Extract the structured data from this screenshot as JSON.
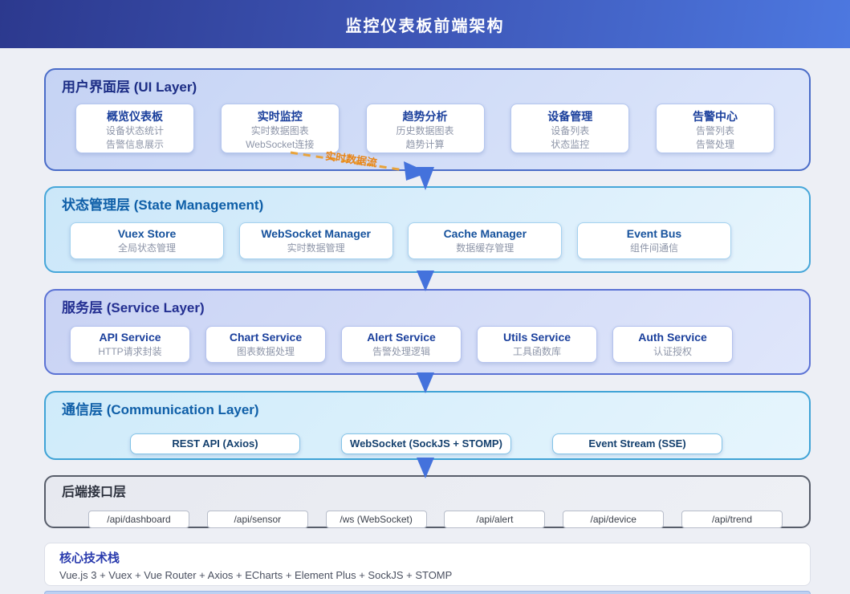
{
  "header": {
    "title": "监控仪表板前端架构"
  },
  "layers": [
    {
      "title": "用户界面层 (UI Layer)",
      "cards": [
        {
          "title": "概览仪表板",
          "lines": [
            "设备状态统计",
            "告警信息展示"
          ]
        },
        {
          "title": "实时监控",
          "lines": [
            "实时数据图表",
            "WebSocket连接"
          ]
        },
        {
          "title": "趋势分析",
          "lines": [
            "历史数据图表",
            "趋势计算"
          ]
        },
        {
          "title": "设备管理",
          "lines": [
            "设备列表",
            "状态监控"
          ]
        },
        {
          "title": "告警中心",
          "lines": [
            "告警列表",
            "告警处理"
          ]
        }
      ]
    },
    {
      "title": "状态管理层 (State Management)",
      "cards": [
        {
          "title": "Vuex Store",
          "lines": [
            "全局状态管理"
          ]
        },
        {
          "title": "WebSocket Manager",
          "lines": [
            "实时数据管理"
          ]
        },
        {
          "title": "Cache Manager",
          "lines": [
            "数据缓存管理"
          ]
        },
        {
          "title": "Event Bus",
          "lines": [
            "组件间通信"
          ]
        }
      ]
    },
    {
      "title": "服务层 (Service Layer)",
      "cards": [
        {
          "title": "API Service",
          "lines": [
            "HTTP请求封装"
          ]
        },
        {
          "title": "Chart Service",
          "lines": [
            "图表数据处理"
          ]
        },
        {
          "title": "Alert Service",
          "lines": [
            "告警处理逻辑"
          ]
        },
        {
          "title": "Utils Service",
          "lines": [
            "工具函数库"
          ]
        },
        {
          "title": "Auth Service",
          "lines": [
            "认证授权"
          ]
        }
      ]
    },
    {
      "title": "通信层 (Communication Layer)",
      "cards": [
        {
          "title": "REST API (Axios)"
        },
        {
          "title": "WebSocket (SockJS + STOMP)"
        },
        {
          "title": "Event Stream (SSE)"
        }
      ]
    },
    {
      "title": "后端接口层",
      "cards": [
        {
          "title": "/api/dashboard"
        },
        {
          "title": "/api/sensor"
        },
        {
          "title": "/ws (WebSocket)"
        },
        {
          "title": "/api/alert"
        },
        {
          "title": "/api/device"
        },
        {
          "title": "/api/trend"
        }
      ]
    }
  ],
  "flow_label": "实时数据流",
  "tech_stack": {
    "title": "核心技术栈",
    "items": "Vue.js 3 + Vuex + Vue Router + Axios + ECharts + Element Plus + SockJS + STOMP"
  },
  "colors": {
    "header_gradient_start": "#2c398e",
    "header_gradient_end": "#4d78e0",
    "arrow_blue": "#4472dc",
    "flow_dash_orange": "#e8a33c",
    "flow_label_orange": "#e8861a"
  }
}
